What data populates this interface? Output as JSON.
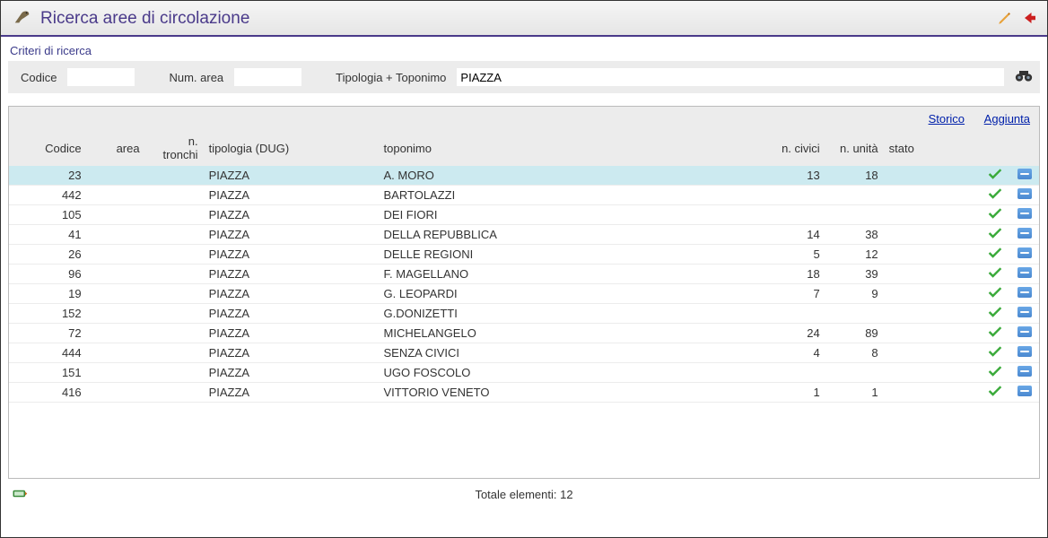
{
  "header": {
    "title": "Ricerca aree di circolazione"
  },
  "criteria": {
    "section_title": "Criteri di ricerca",
    "codice_label": "Codice",
    "codice_value": "",
    "num_area_label": "Num. area",
    "num_area_value": "",
    "tipologia_label": "Tipologia + Toponimo",
    "tipologia_value": "PIAZZA"
  },
  "toolbar": {
    "storico_label": "Storico",
    "aggiunta_label": "Aggiunta"
  },
  "columns": {
    "codice": "Codice",
    "area": "area",
    "tronchi": "n. tronchi",
    "tipologia": "tipologia (DUG)",
    "toponimo": "toponimo",
    "civici": "n. civici",
    "unita": "n. unità",
    "stato": "stato"
  },
  "rows": [
    {
      "codice": "23",
      "area": "",
      "tronchi": "",
      "tipologia": "PIAZZA",
      "toponimo": "A. MORO",
      "civici": "13",
      "unita": "18",
      "stato": "",
      "selected": true
    },
    {
      "codice": "442",
      "area": "",
      "tronchi": "",
      "tipologia": "PIAZZA",
      "toponimo": "BARTOLAZZI",
      "civici": "",
      "unita": "",
      "stato": ""
    },
    {
      "codice": "105",
      "area": "",
      "tronchi": "",
      "tipologia": "PIAZZA",
      "toponimo": "DEI FIORI",
      "civici": "",
      "unita": "",
      "stato": ""
    },
    {
      "codice": "41",
      "area": "",
      "tronchi": "",
      "tipologia": "PIAZZA",
      "toponimo": "DELLA REPUBBLICA",
      "civici": "14",
      "unita": "38",
      "stato": ""
    },
    {
      "codice": "26",
      "area": "",
      "tronchi": "",
      "tipologia": "PIAZZA",
      "toponimo": "DELLE REGIONI",
      "civici": "5",
      "unita": "12",
      "stato": ""
    },
    {
      "codice": "96",
      "area": "",
      "tronchi": "",
      "tipologia": "PIAZZA",
      "toponimo": "F. MAGELLANO",
      "civici": "18",
      "unita": "39",
      "stato": ""
    },
    {
      "codice": "19",
      "area": "",
      "tronchi": "",
      "tipologia": "PIAZZA",
      "toponimo": "G. LEOPARDI",
      "civici": "7",
      "unita": "9",
      "stato": ""
    },
    {
      "codice": "152",
      "area": "",
      "tronchi": "",
      "tipologia": "PIAZZA",
      "toponimo": "G.DONIZETTI",
      "civici": "",
      "unita": "",
      "stato": ""
    },
    {
      "codice": "72",
      "area": "",
      "tronchi": "",
      "tipologia": "PIAZZA",
      "toponimo": "MICHELANGELO",
      "civici": "24",
      "unita": "89",
      "stato": ""
    },
    {
      "codice": "444",
      "area": "",
      "tronchi": "",
      "tipologia": "PIAZZA",
      "toponimo": "SENZA CIVICI",
      "civici": "4",
      "unita": "8",
      "stato": ""
    },
    {
      "codice": "151",
      "area": "",
      "tronchi": "",
      "tipologia": "PIAZZA",
      "toponimo": "UGO FOSCOLO",
      "civici": "",
      "unita": "",
      "stato": ""
    },
    {
      "codice": "416",
      "area": "",
      "tronchi": "",
      "tipologia": "PIAZZA",
      "toponimo": "VITTORIO VENETO",
      "civici": "1",
      "unita": "1",
      "stato": ""
    }
  ],
  "footer": {
    "total_label": "Totale elementi: 12"
  }
}
